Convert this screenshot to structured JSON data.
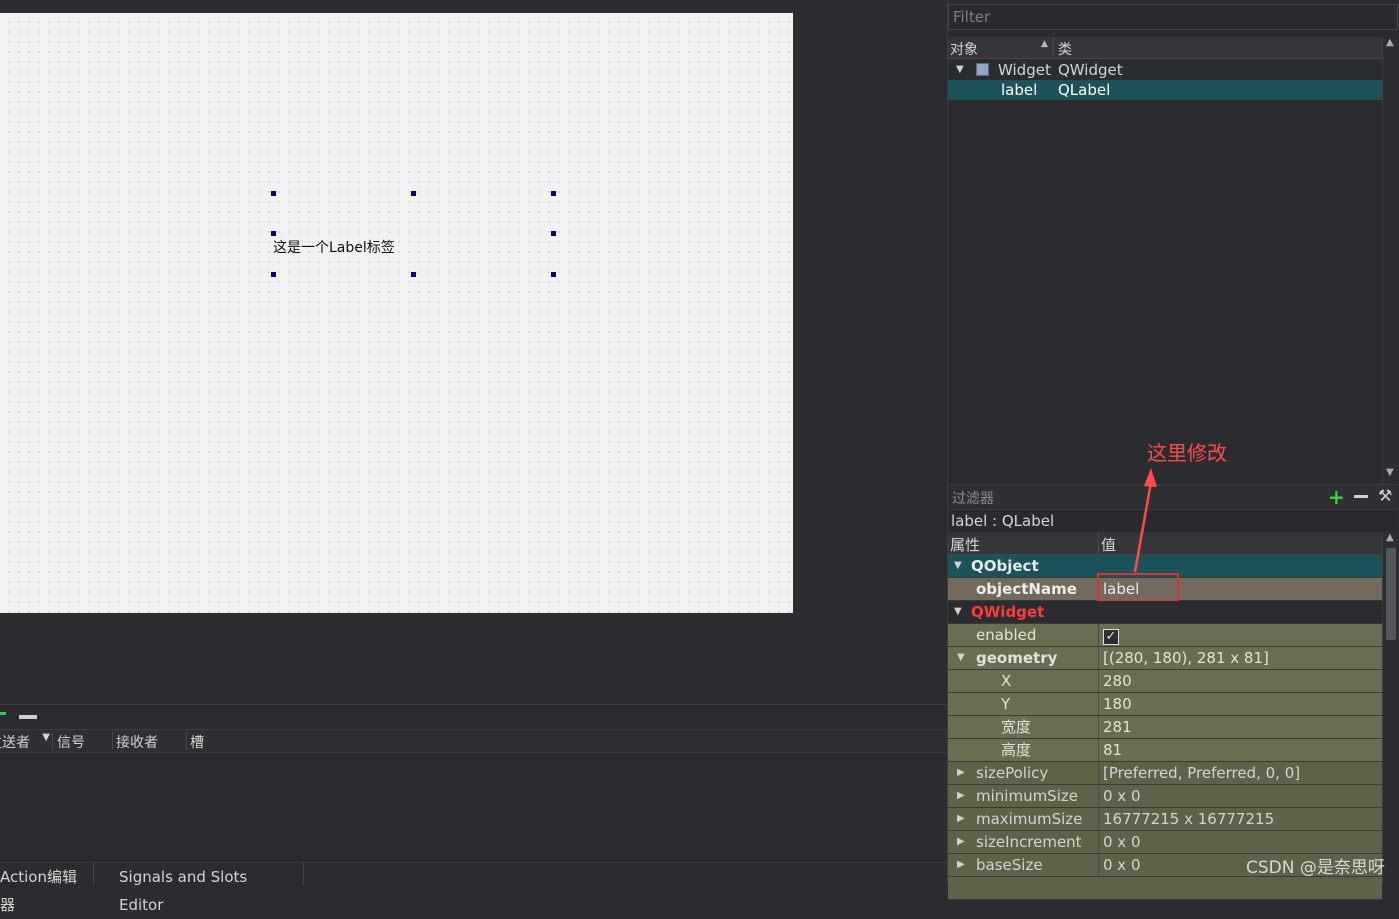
{
  "canvas": {
    "label_text": "这是一个Label标签"
  },
  "signals_panel": {
    "columns": [
      "发送者",
      "信号",
      "接收者",
      "槽"
    ],
    "tabs": [
      "Action编辑器",
      "Signals and Slots Editor"
    ]
  },
  "object_inspector": {
    "filter_placeholder": "Filter",
    "header": {
      "object": "对象",
      "class": "类"
    },
    "rows": [
      {
        "object": "Widget",
        "class": "QWidget"
      },
      {
        "object": "label",
        "class": "QLabel"
      }
    ]
  },
  "property_editor": {
    "filter_label": "过滤器",
    "class_line": "label : QLabel",
    "header": {
      "property": "属性",
      "value": "值"
    },
    "groups": {
      "qobject": "QObject",
      "qwidget": "QWidget"
    },
    "rows": [
      {
        "name": "objectName",
        "value": "label"
      },
      {
        "name": "enabled",
        "value": "✓"
      },
      {
        "name": "geometry",
        "value": "[(280, 180), 281 x 81]"
      },
      {
        "name": "X",
        "value": "280"
      },
      {
        "name": "Y",
        "value": "180"
      },
      {
        "name": "宽度",
        "value": "281"
      },
      {
        "name": "高度",
        "value": "81"
      },
      {
        "name": "sizePolicy",
        "value": "[Preferred, Preferred, 0, 0]"
      },
      {
        "name": "minimumSize",
        "value": "0 x 0"
      },
      {
        "name": "maximumSize",
        "value": "16777215 x 16777215"
      },
      {
        "name": "sizeIncrement",
        "value": "0 x 0"
      },
      {
        "name": "baseSize",
        "value": "0 x 0"
      }
    ]
  },
  "annotation": {
    "text": "这里修改",
    "color": "#ff4a4a"
  },
  "watermark": "CSDN @是奈思呀",
  "colors": {
    "selection": "#1c525a",
    "highlight_box": "#e03030",
    "qwidget_group": "#ff3b3b"
  }
}
